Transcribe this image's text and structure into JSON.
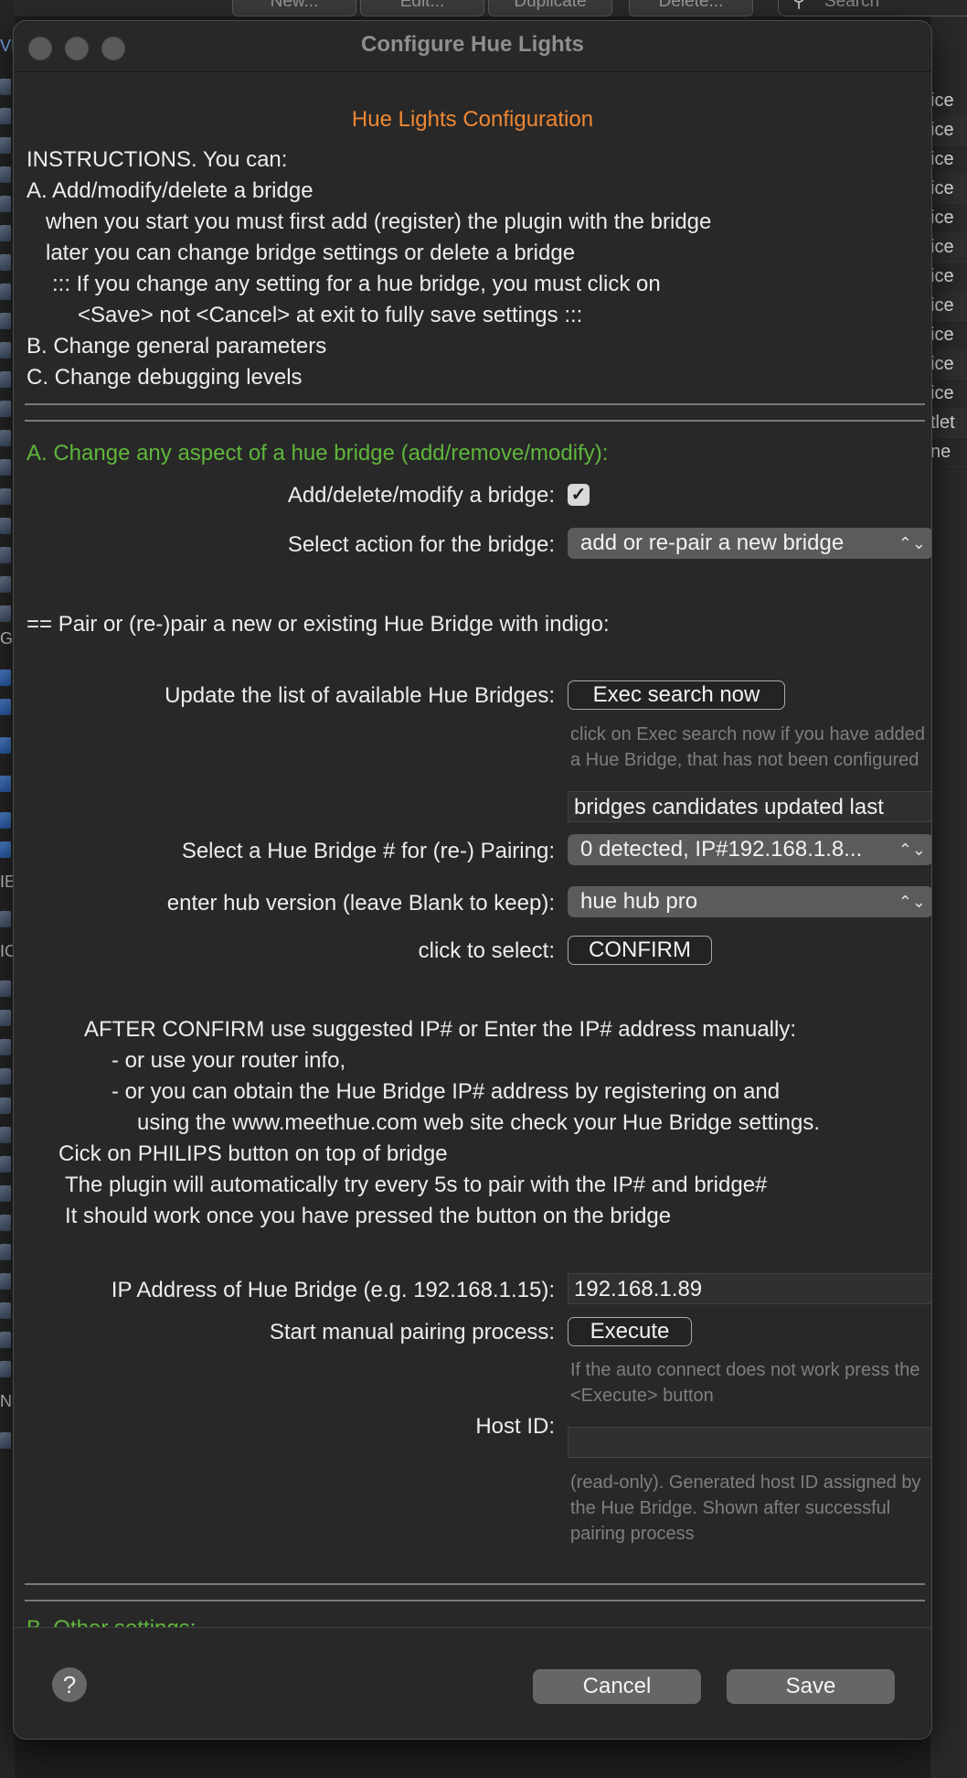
{
  "background_app": {
    "toolbar_buttons": [
      "New...",
      "Edit...",
      "Duplicate",
      "Delete..."
    ],
    "search_placeholder": "Search",
    "right_column": [
      "ice",
      "ice",
      "ice",
      "ice",
      "ice",
      "ice",
      "ice",
      "ice",
      "ice",
      "ice",
      "ice",
      "tlet",
      "ne"
    ],
    "left_letters": [
      "VI",
      "G",
      "IE",
      "IC",
      "N"
    ]
  },
  "dialog": {
    "window_title": "Configure Hue Lights",
    "heading": "Hue Lights Configuration",
    "instructions": [
      "INSTRUCTIONS.  You can:",
      "A. Add/modify/delete a bridge",
      "when you start you must first add (register) the plugin with the bridge",
      "later you can change bridge settings or delete a bridge",
      "::: If you change any setting for a hue bridge, you must click on",
      "<Save> not <Cancel> at exit to fully save settings :::",
      "B. Change general parameters",
      "C. Change debugging levels"
    ],
    "section_a_title": "A. Change any aspect of a hue bridge (add/remove/modify):",
    "add_delete_label": "Add/delete/modify a bridge:",
    "add_delete_checked": "✓",
    "select_action_label": "Select action for the bridge:",
    "select_action_value": "add or re-pair a new bridge",
    "pair_heading": "== Pair or (re-)pair a  new or existing Hue Bridge with indigo:",
    "update_list_label": "Update the list of available Hue Bridges:",
    "exec_search_button": "Exec search now",
    "exec_search_hint": "click on Exec search now if you have added a Hue Bridge, that has not been configured",
    "candidates_value": "bridges candidates updated last",
    "select_bridge_label": "Select a Hue Bridge # for (re-) Pairing:",
    "select_bridge_value": "0  detected, IP#192.168.1.8...",
    "hub_version_label": "enter hub version (leave Blank to keep):",
    "hub_version_value": "hue hub pro",
    "click_select_label": "click to select:",
    "confirm_button": "CONFIRM",
    "after_confirm": [
      "AFTER CONFIRM use suggested IP# or Enter the IP# address manually:",
      "- or use your router info,",
      "- or you can obtain the Hue Bridge IP# address by registering on and",
      "using the www.meethue.com web site check your Hue Bridge settings.",
      "Cick on PHILIPS button on top of bridge",
      "The plugin will automatically try every 5s to pair with the IP# and bridge#",
      "It should work once you have pressed the button on the bridge"
    ],
    "ip_label": "IP Address of Hue Bridge (e.g. 192.168.1.15):",
    "ip_value": "192.168.1.89",
    "manual_pair_label": "Start manual pairing process:",
    "execute_button": "Execute",
    "execute_hint": "If the auto connect does not work press the <Execute> button",
    "host_id_label": "Host ID:",
    "host_id_value": "",
    "host_id_hint": "(read-only). Generated host ID assigned by the Hue Bridge. Shown after successful pairing process",
    "section_b_title": "B. Other settings:",
    "help_button": "?",
    "cancel_button": "Cancel",
    "save_button": "Save"
  },
  "colors": {
    "heading_orange": "#ee8733",
    "section_green": "#5fb63c",
    "dialog_bg": "#282828"
  }
}
